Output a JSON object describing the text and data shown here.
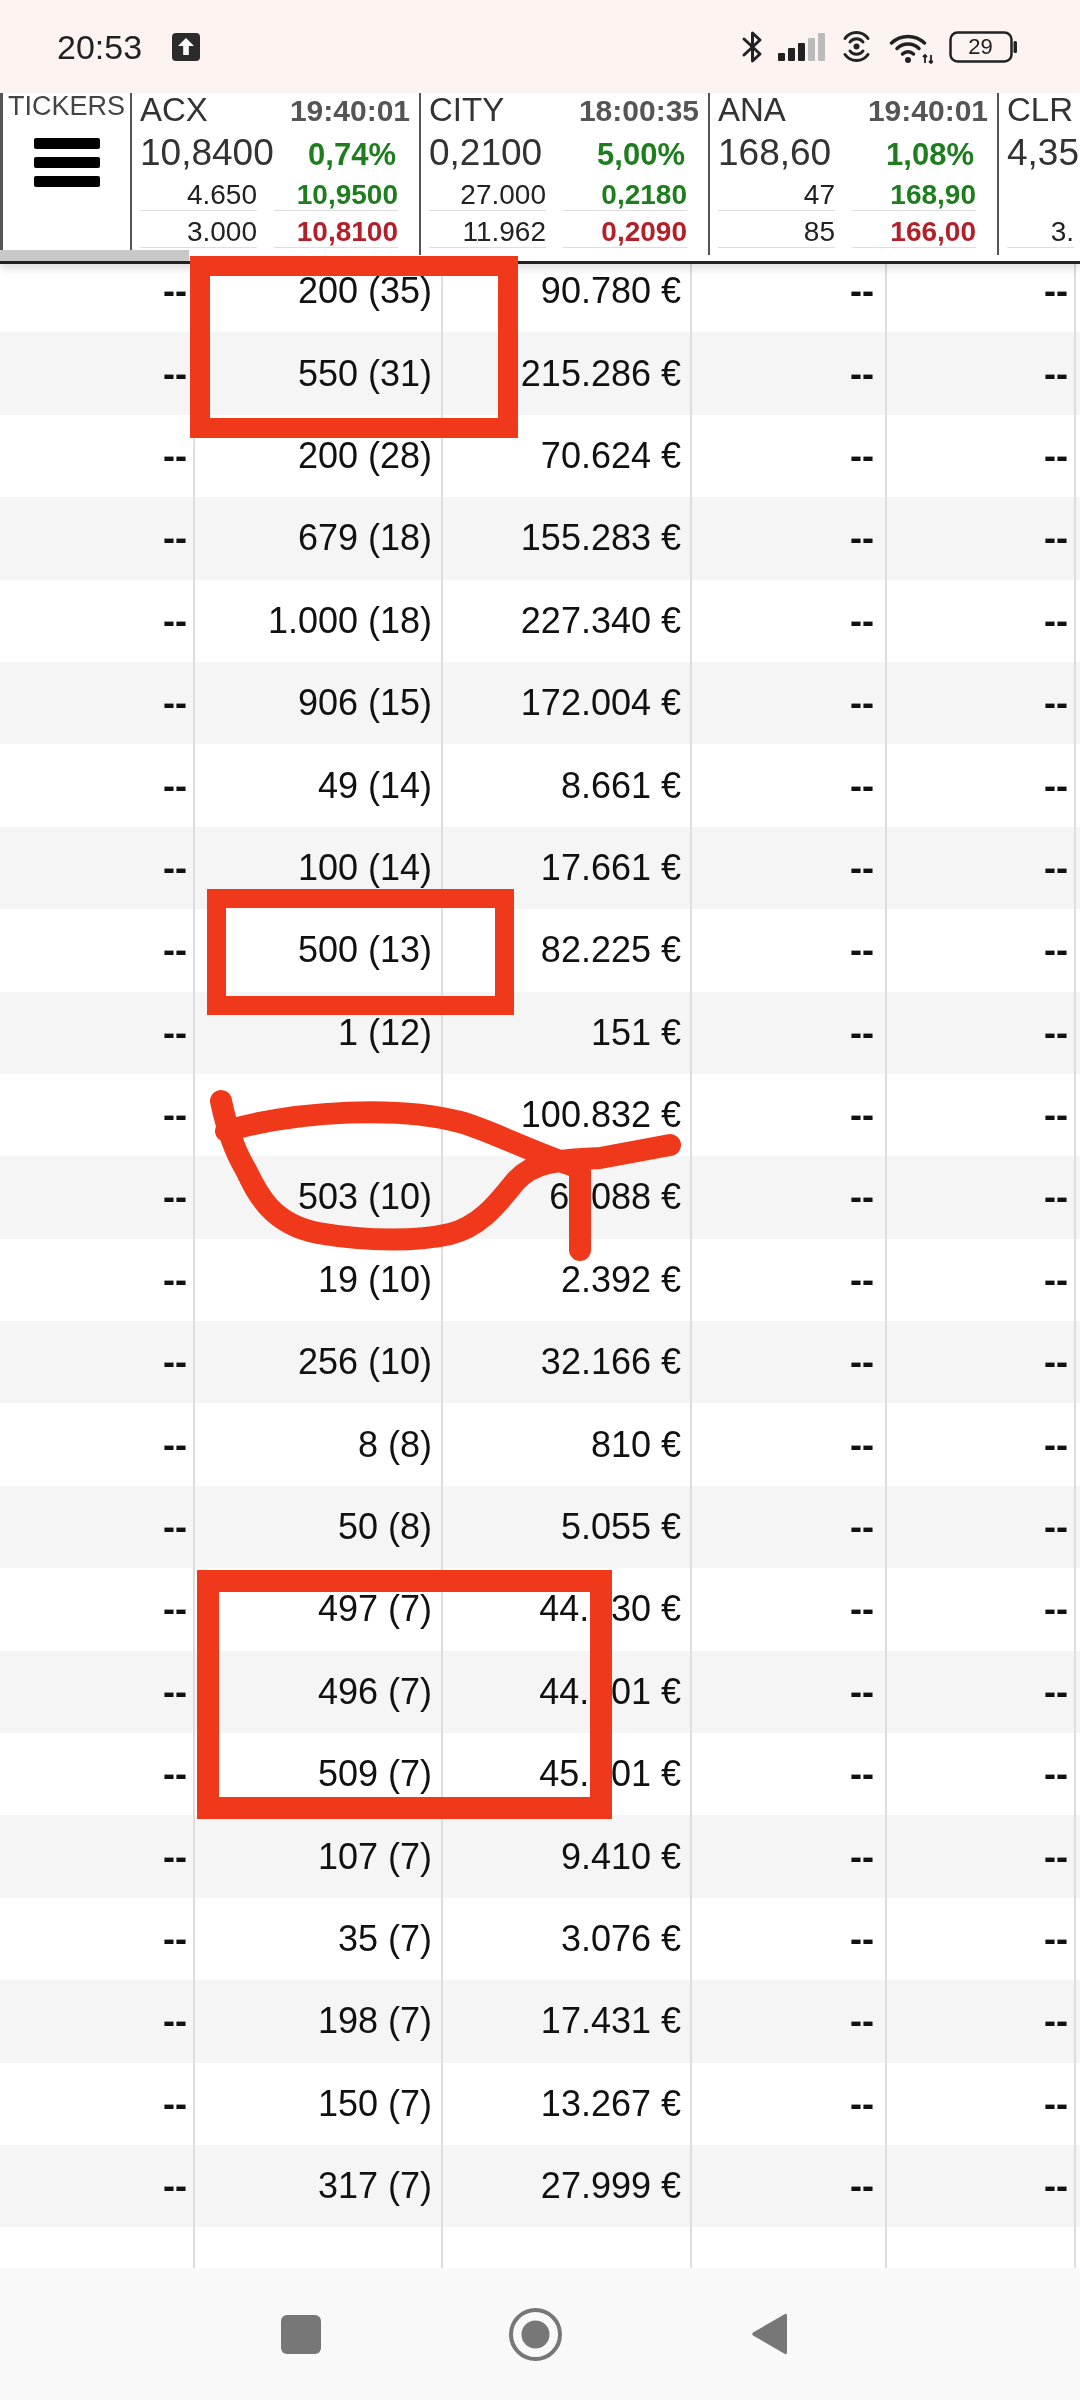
{
  "status_bar": {
    "time": "20:53",
    "battery": "29"
  },
  "tickers_panel": {
    "label": "TICKERS"
  },
  "tickers": [
    {
      "symbol": "ACX",
      "time": "19:40:01",
      "price": "10,8400",
      "change": "0,74%",
      "upper_quantity": "4.650",
      "upper_price": "10,9500",
      "lower_quantity": "3.000",
      "lower_price": "10,8100"
    },
    {
      "symbol": "CITY",
      "time": "18:00:35",
      "price": "0,2100",
      "change": "5,00%",
      "upper_quantity": "27.000",
      "upper_price": "0,2180",
      "lower_quantity": "11.962",
      "lower_price": "0,2090"
    },
    {
      "symbol": "ANA",
      "time": "19:40:01",
      "price": "168,60",
      "change": "1,08%",
      "upper_quantity": "47",
      "upper_price": "168,90",
      "lower_quantity": "85",
      "lower_price": "166,00"
    },
    {
      "symbol": "CLR",
      "price": "4,35",
      "lower_quantity": "3."
    }
  ],
  "table": {
    "rows": [
      {
        "column_1": "--",
        "column_2": "200 (35)",
        "column_3": "90.780 €",
        "column_4": "--",
        "column_5": "--"
      },
      {
        "column_1": "--",
        "column_2": "550 (31)",
        "column_3": "215.286 €",
        "column_4": "--",
        "column_5": "--"
      },
      {
        "column_1": "--",
        "column_2": "200 (28)",
        "column_3": "70.624 €",
        "column_4": "--",
        "column_5": "--"
      },
      {
        "column_1": "--",
        "column_2": "679 (18)",
        "column_3": "155.283 €",
        "column_4": "--",
        "column_5": "--"
      },
      {
        "column_1": "--",
        "column_2": "1.000 (18)",
        "column_3": "227.340 €",
        "column_4": "--",
        "column_5": "--"
      },
      {
        "column_1": "--",
        "column_2": "906 (15)",
        "column_3": "172.004 €",
        "column_4": "--",
        "column_5": "--"
      },
      {
        "column_1": "--",
        "column_2": "49 (14)",
        "column_3": "8.661 €",
        "column_4": "--",
        "column_5": "--"
      },
      {
        "column_1": "--",
        "column_2": "100 (14)",
        "column_3": "17.661 €",
        "column_4": "--",
        "column_5": "--"
      },
      {
        "column_1": "--",
        "column_2": "500 (13)",
        "column_3": "82.225 €",
        "column_4": "--",
        "column_5": "--"
      },
      {
        "column_1": "--",
        "column_2": "1 (12)",
        "column_3": "151 €",
        "column_4": "--",
        "column_5": "--"
      },
      {
        "column_1": "--",
        "column_3": "100.832 €",
        "column_4": "--",
        "column_5": "--"
      },
      {
        "column_1": "--",
        "column_2": "503 (10)",
        "column_3": [
          "6",
          "088 €"
        ],
        "column_4": "--",
        "column_5": "--"
      },
      {
        "column_1": "--",
        "column_2": "19 (10)",
        "column_3": "2.392 €",
        "column_4": "--",
        "column_5": "--"
      },
      {
        "column_1": "--",
        "column_2": "256 (10)",
        "column_3": "32.166 €",
        "column_4": "--",
        "column_5": "--"
      },
      {
        "column_1": "--",
        "column_2": "8 (8)",
        "column_3": "810 €",
        "column_4": "--",
        "column_5": "--"
      },
      {
        "column_1": "--",
        "column_2": "50 (8)",
        "column_3": "5.055 €",
        "column_4": "--",
        "column_5": "--"
      },
      {
        "column_1": "--",
        "column_2": "497 (7)",
        "column_3": [
          "44.",
          "30 €"
        ],
        "column_4": "--",
        "column_5": "--"
      },
      {
        "column_1": "--",
        "column_2": "496 (7)",
        "column_3": [
          "44.",
          "01 €"
        ],
        "column_4": "--",
        "column_5": "--"
      },
      {
        "column_1": "--",
        "column_2": "509 (7)",
        "column_3": [
          "45.",
          "01 €"
        ],
        "column_4": "--",
        "column_5": "--"
      },
      {
        "column_1": "--",
        "column_2": "107 (7)",
        "column_3": "9.410 €",
        "column_4": "--",
        "column_5": "--"
      },
      {
        "column_1": "--",
        "column_2": "35 (7)",
        "column_3": "3.076 €",
        "column_4": "--",
        "column_5": "--"
      },
      {
        "column_1": "--",
        "column_2": "198 (7)",
        "column_3": "17.431 €",
        "column_4": "--",
        "column_5": "--"
      },
      {
        "column_1": "--",
        "column_2": "150 (7)",
        "column_3": "13.267 €",
        "column_4": "--",
        "column_5": "--"
      },
      {
        "column_1": "--",
        "column_2": "317 (7)",
        "column_3": "27.999 €",
        "column_4": "--",
        "column_5": "--"
      }
    ]
  },
  "annotations": [
    {
      "kind": "rectangle"
    },
    {
      "kind": "rectangle"
    },
    {
      "kind": "scribble"
    },
    {
      "kind": "rectangle"
    }
  ]
}
